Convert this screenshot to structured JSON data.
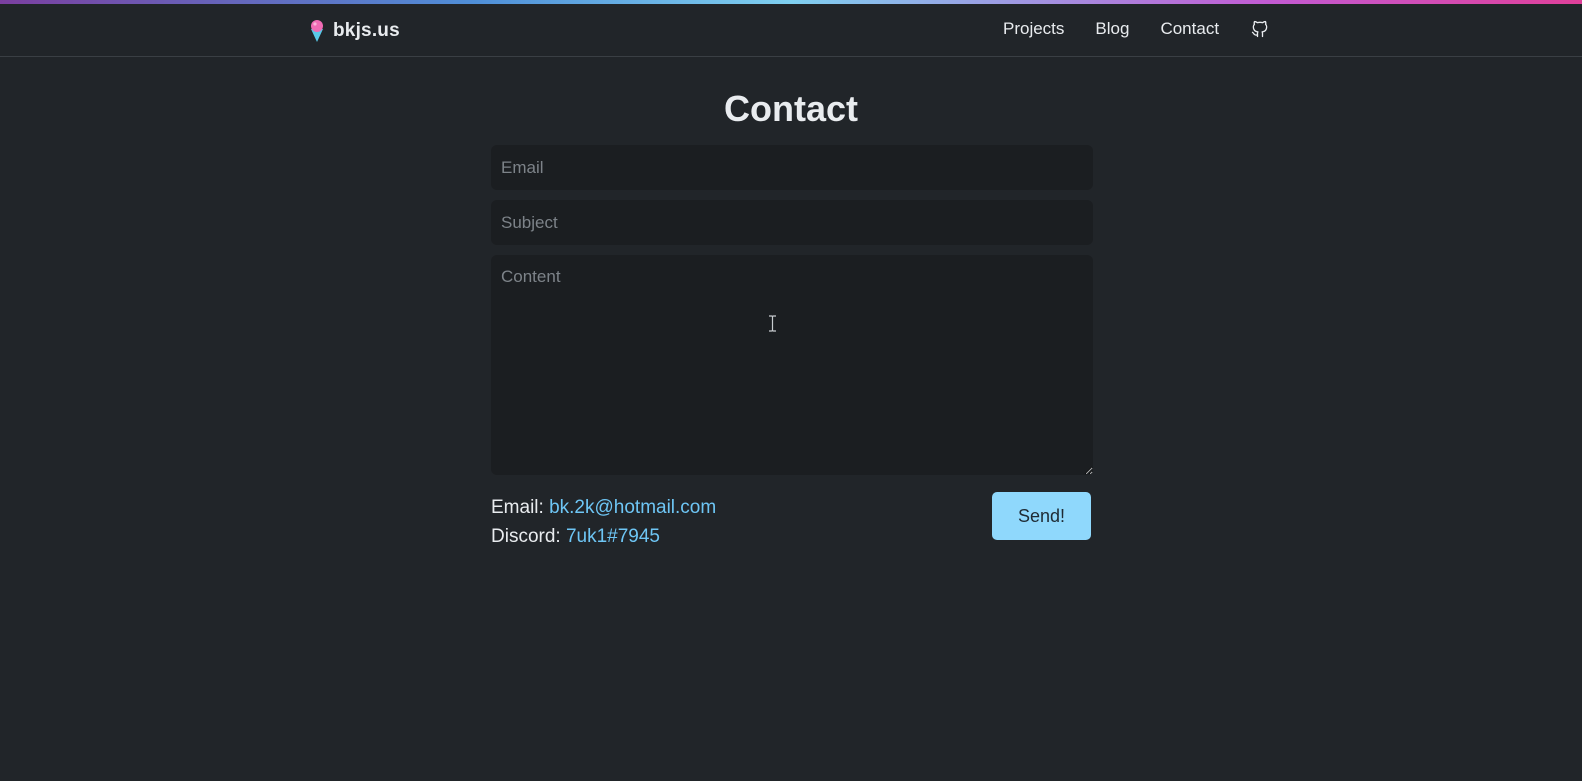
{
  "site": {
    "brand_name": "bkjs.us",
    "brand_icon": "shaved-ice-icon",
    "accent_color": "#8fd8fc",
    "link_color": "#6ec6f5"
  },
  "nav": {
    "items": [
      {
        "label": "Projects"
      },
      {
        "label": "Blog"
      },
      {
        "label": "Contact"
      }
    ],
    "github_icon": "github-icon"
  },
  "page": {
    "title": "Contact"
  },
  "form": {
    "email_placeholder": "Email",
    "subject_placeholder": "Subject",
    "content_placeholder": "Content",
    "send_label": "Send!"
  },
  "contact_info": {
    "email_label": "Email: ",
    "email_value": "bk.2k@hotmail.com",
    "discord_label": "Discord: ",
    "discord_value": "7uk1#7945"
  }
}
